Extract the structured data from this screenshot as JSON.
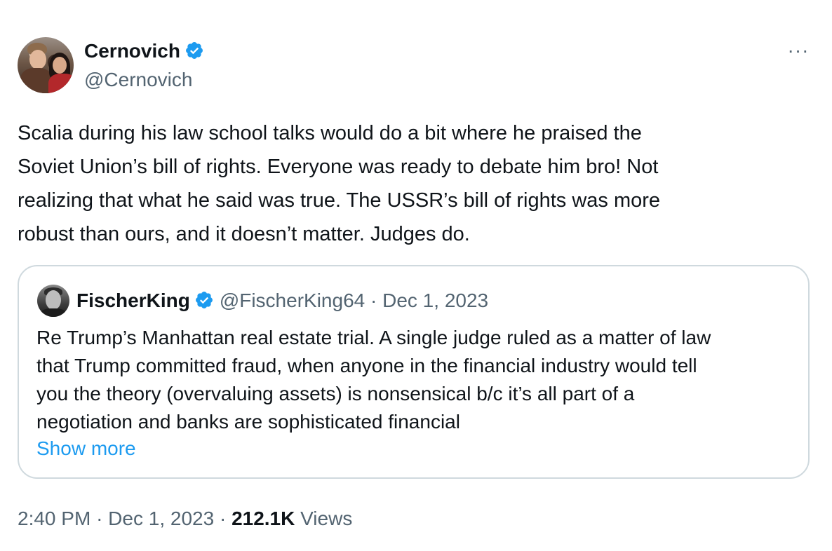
{
  "author": {
    "display_name": "Cernovich",
    "handle": "@Cernovich",
    "verified": true
  },
  "more_icon_label": "···",
  "tweet_text": "Scalia during his law school talks would do a bit where he praised the\nSoviet Union’s bill of rights. Everyone was ready to debate him bro! Not\nrealizing that what he said was true. The USSR’s bill of rights was more\nrobust than ours, and it doesn’t matter. Judges do.",
  "quote": {
    "display_name": "FischerKing",
    "handle": "@FischerKing64",
    "separator": "·",
    "date": "Dec 1, 2023",
    "text": "Re Trump’s Manhattan real estate trial. A single judge ruled as a matter of law\nthat Trump committed fraud, when anyone in the financial industry would tell\nyou the theory (overvaluing assets) is nonsensical b/c it’s all part of a\nnegotiation and banks are sophisticated financial",
    "show_more": "Show more"
  },
  "footer": {
    "time": "2:40 PM",
    "sep1": "·",
    "date": "Dec 1, 2023",
    "sep2": "·",
    "views_count": "212.1K",
    "views_label": "Views"
  },
  "colors": {
    "verified": "#1d9bf0",
    "link": "#1d9bf0",
    "muted": "#536471",
    "text": "#0f1419",
    "border": "#cfd9de"
  }
}
